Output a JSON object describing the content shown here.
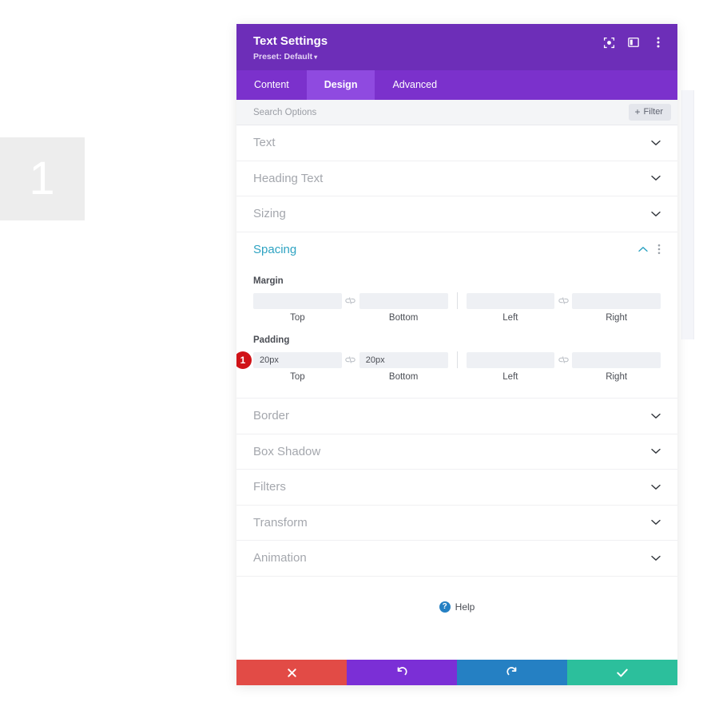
{
  "page_marker": {
    "number": "1"
  },
  "panel": {
    "header": {
      "title": "Text Settings",
      "preset_label": "Preset: Default",
      "preset_caret": "▾",
      "actions": [
        {
          "name": "focus-mode-icon",
          "title": "Focus Mode"
        },
        {
          "name": "layout-toggle-icon",
          "title": "Change Layout"
        },
        {
          "name": "more-options-icon",
          "title": "More Options"
        }
      ]
    },
    "tabs": [
      {
        "label": "Content",
        "active": false
      },
      {
        "label": "Design",
        "active": true
      },
      {
        "label": "Advanced",
        "active": false
      }
    ],
    "search": {
      "placeholder": "Search Options",
      "value": "",
      "filter_label": "Filter",
      "filter_plus": "+"
    },
    "sections": [
      {
        "label": "Text",
        "open": false
      },
      {
        "label": "Heading Text",
        "open": false
      },
      {
        "label": "Sizing",
        "open": false
      },
      {
        "label": "Spacing",
        "open": true
      },
      {
        "label": "Border",
        "open": false
      },
      {
        "label": "Box Shadow",
        "open": false
      },
      {
        "label": "Filters",
        "open": false
      },
      {
        "label": "Transform",
        "open": false
      },
      {
        "label": "Animation",
        "open": false
      }
    ],
    "spacing": {
      "title": "Spacing",
      "margin": {
        "label": "Margin",
        "top": {
          "value": "",
          "caption": "Top"
        },
        "bottom": {
          "value": "",
          "caption": "Bottom"
        },
        "left": {
          "value": "",
          "caption": "Left"
        },
        "right": {
          "value": "",
          "caption": "Right"
        }
      },
      "padding": {
        "label": "Padding",
        "badge": "1",
        "top": {
          "value": "20px",
          "caption": "Top"
        },
        "bottom": {
          "value": "20px",
          "caption": "Bottom"
        },
        "left": {
          "value": "",
          "caption": "Left"
        },
        "right": {
          "value": "",
          "caption": "Right"
        }
      }
    },
    "help": {
      "label": "Help",
      "icon_glyph": "?"
    },
    "footer": [
      {
        "name": "cancel-button",
        "icon": "close-icon"
      },
      {
        "name": "undo-button",
        "icon": "undo-icon"
      },
      {
        "name": "redo-button",
        "icon": "redo-icon"
      },
      {
        "name": "save-button",
        "icon": "check-icon"
      }
    ]
  },
  "colors": {
    "header_purple": "#6d2eb8",
    "tabs_purple": "#7b31cc",
    "active_tab_purple": "#8f4ae0",
    "open_section_teal": "#2ea3c2",
    "badge_red": "#d01217",
    "cancel_red": "#e24b46",
    "undo_purple": "#7b2fd6",
    "redo_blue": "#2580c3",
    "save_green": "#2cbf9c"
  }
}
